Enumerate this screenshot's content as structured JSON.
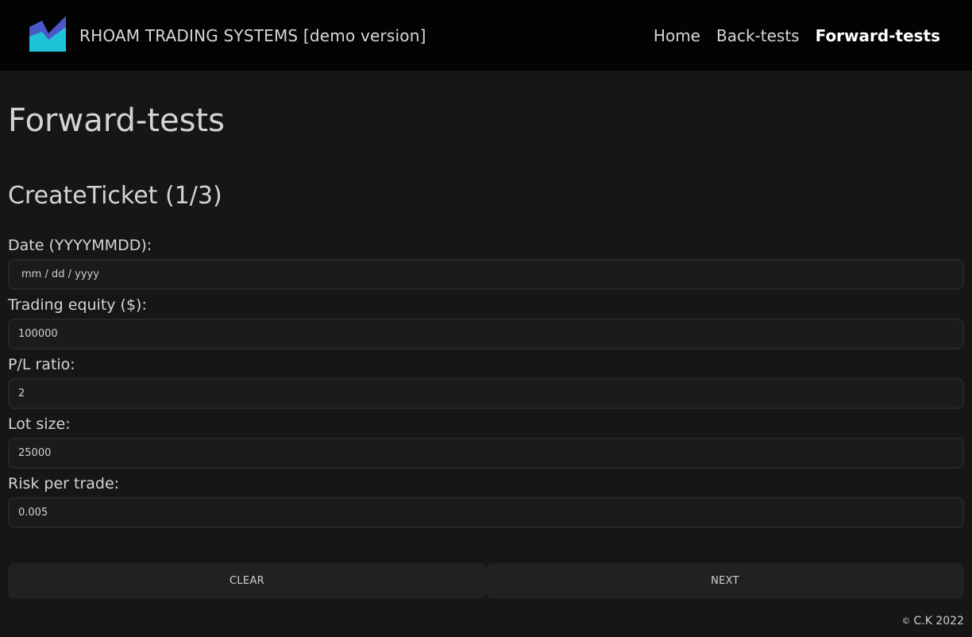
{
  "header": {
    "logo_icon": "area-chart-logo-icon",
    "brand_text": "RHOAM TRADING SYSTEMS [demo version]",
    "nav": [
      {
        "label": "Home",
        "active": false
      },
      {
        "label": "Back-tests",
        "active": false
      },
      {
        "label": "Forward-tests",
        "active": true
      }
    ]
  },
  "main": {
    "page_title": "Forward-tests",
    "section_title": "CreateTicket (1/3)",
    "fields": {
      "date": {
        "label": "Date (YYYYMMDD):",
        "value": "",
        "placeholder": "mm / dd / yyyy"
      },
      "equity": {
        "label": "Trading equity ($):",
        "value": "100000",
        "placeholder": ""
      },
      "pl_ratio": {
        "label": "P/L ratio:",
        "value": "2",
        "placeholder": ""
      },
      "lot_size": {
        "label": "Lot size:",
        "value": "25000",
        "placeholder": ""
      },
      "risk": {
        "label": "Risk per trade:",
        "value": "0.005",
        "placeholder": ""
      }
    },
    "buttons": {
      "clear": "CLEAR",
      "next": "NEXT"
    }
  },
  "footer": {
    "copyright_symbol": "©",
    "text": "C.K 2022"
  },
  "colors": {
    "background": "#161616",
    "header_bg": "#030303",
    "logo_blue": "#4a57c7",
    "logo_cyan": "#1fc3d8"
  }
}
